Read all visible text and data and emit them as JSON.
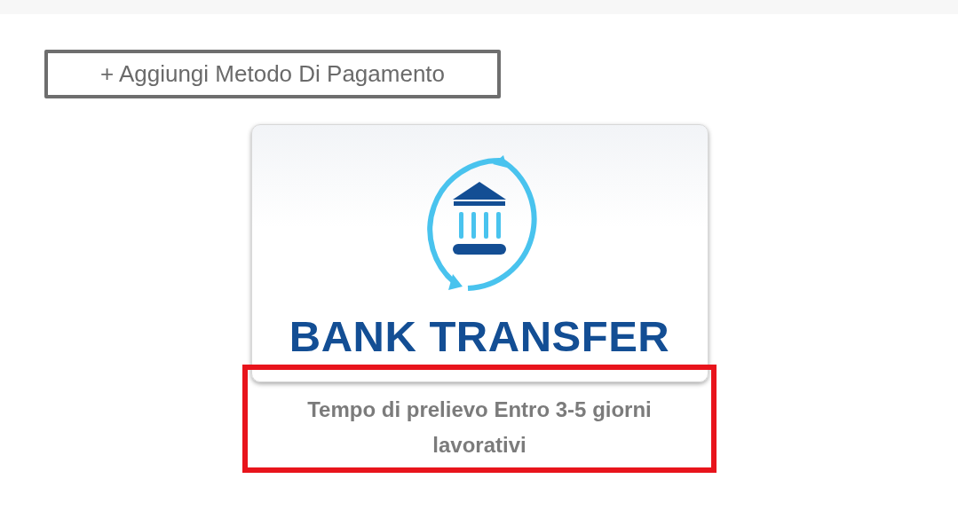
{
  "add_button": {
    "label": "+ Aggiungi Metodo Di Pagamento"
  },
  "methods": [
    {
      "kind": "bank",
      "title": "BANK TRANSFER",
      "note": "Tempo di prelievo Entro 3-5 giorni lavorativi",
      "highlighted": true
    }
  ]
}
